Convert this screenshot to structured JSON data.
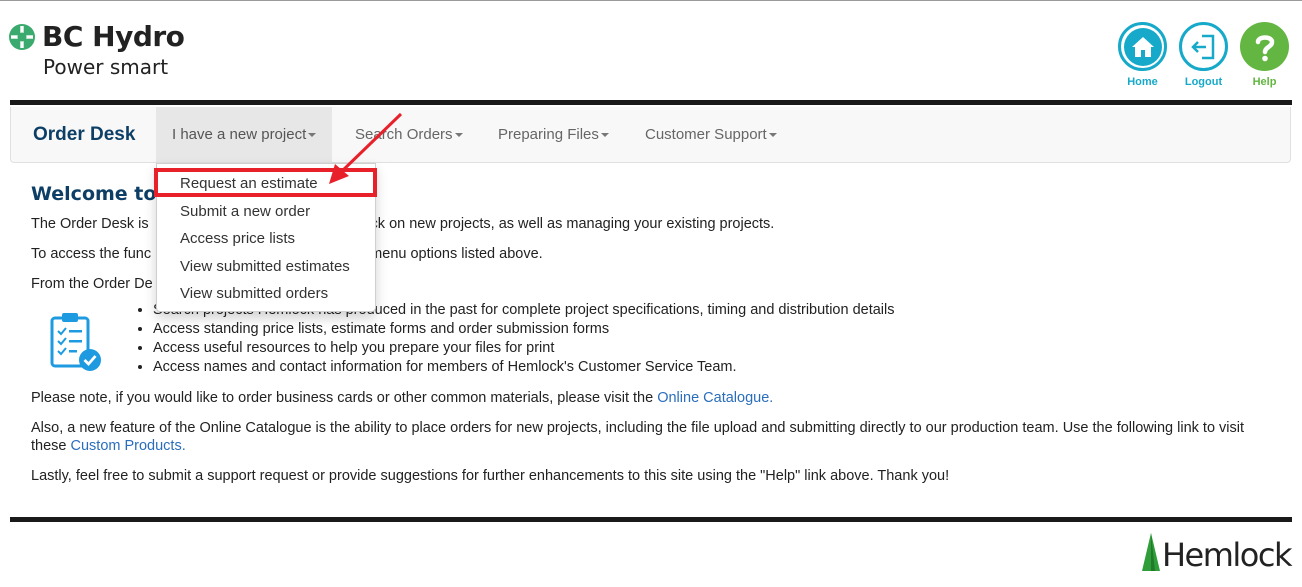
{
  "header": {
    "brand": "BC Hydro",
    "tagline": "Power smart",
    "nav": [
      {
        "label": "Home",
        "icon": "home-icon"
      },
      {
        "label": "Logout",
        "icon": "logout-icon"
      },
      {
        "label": "Help",
        "icon": "help-icon"
      }
    ]
  },
  "navbar": {
    "brand": "Order Desk",
    "items": [
      {
        "label": "I have a new project"
      },
      {
        "label": "Search Orders"
      },
      {
        "label": "Preparing Files"
      },
      {
        "label": "Customer Support"
      }
    ]
  },
  "dropdown": {
    "items": [
      {
        "label": "Request an estimate"
      },
      {
        "label": "Submit a new order"
      },
      {
        "label": "Access price lists"
      },
      {
        "label": "View submitted estimates"
      },
      {
        "label": "View submitted orders"
      }
    ]
  },
  "content": {
    "title": "Welcome to",
    "p1_start": "The Order Desk is",
    "p1_end": "Hemlock on new projects, as well as managing your existing projects.",
    "p2_start": "To access the func",
    "p2_end": "e menu options listed above.",
    "p3_start": "From the Order De",
    "features": [
      "Search projects Hemlock has produced in the past for complete project specifications, timing and distribution details",
      "Access standing price lists, estimate forms and order submission forms",
      "Access useful resources to help you prepare your files for print",
      "Access names and contact information for members of Hemlock's Customer Service Team."
    ],
    "note_text": "Please note, if you would like to order business cards or other common materials, please visit the ",
    "note_link": "Online Catalogue.",
    "also_text": "Also, a new feature of the Online Catalogue is the ability to place orders for new projects, including the file upload and submitting directly to our production team. Use the following link to visit these ",
    "also_link": "Custom Products.",
    "lastly": "Lastly, feel free to submit a support request or provide suggestions for further enhancements to this site using the \"Help\" link above. Thank you!"
  },
  "footer": {
    "brand": "Hemlock"
  },
  "colors": {
    "navy": "#0d3f66",
    "teal": "#17a9c9",
    "green": "#62b641",
    "link": "#2a6ebb",
    "annotation_red": "#e8202a"
  }
}
